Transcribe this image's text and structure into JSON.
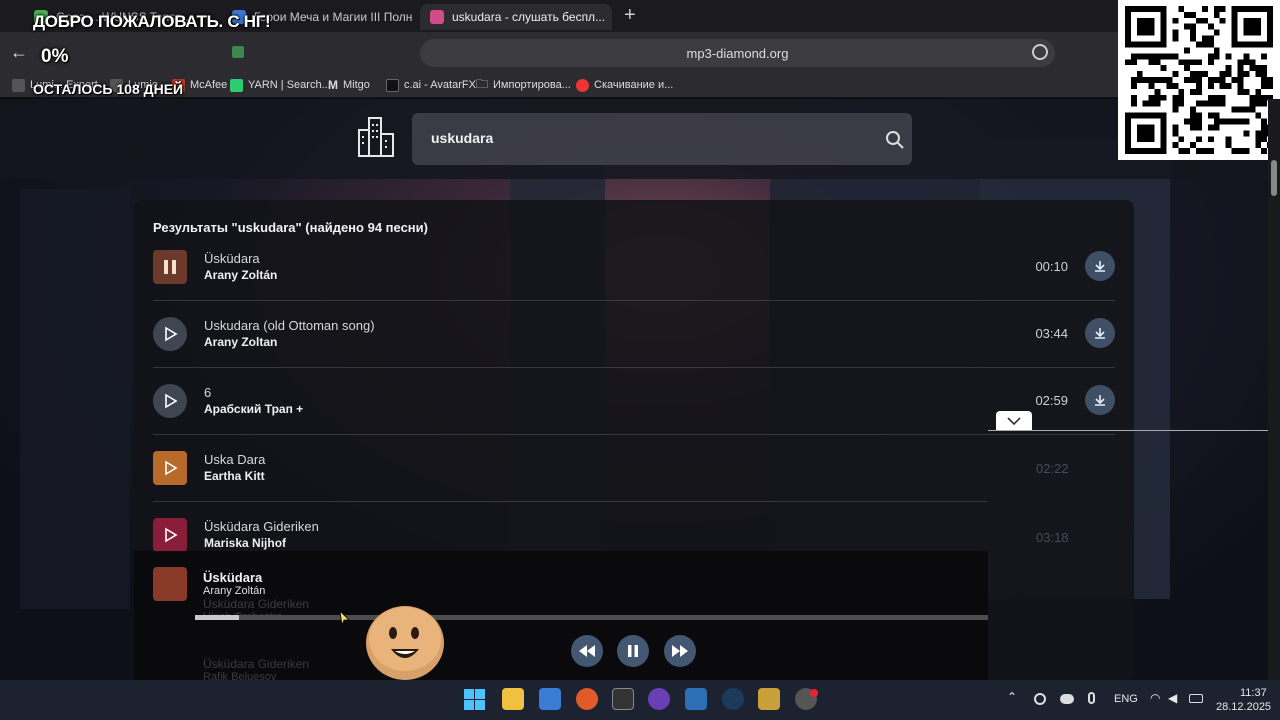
{
  "browser": {
    "tabs": [
      {
        "label": "Goga ... WUNSS Tensa..."
      },
      {
        "label": "Герои Меча и Магии III Полное с..."
      },
      {
        "label": "uskudara - слушать беспл..."
      }
    ],
    "new_tab_label": "+",
    "url": "mp3-diamond.org",
    "bookmarks": [
      {
        "label": "Lumi... Expert"
      },
      {
        "label": "Lumio..."
      },
      {
        "label": "McAfee"
      },
      {
        "label": "YARN | Search..."
      },
      {
        "label": "Mitgo"
      },
      {
        "label": "c.ai - AvatarFX"
      },
      {
        "label": "Импортирова..."
      },
      {
        "label": "Скачивание и..."
      }
    ]
  },
  "overlay": {
    "welcome": "ДОБРО ПОЖАЛОВАТЬ. С НГ!",
    "percent": "0%",
    "days_left": "ОСТАЛОСЬ 108 ДНЕЙ"
  },
  "search": {
    "query": "uskudara"
  },
  "results": {
    "heading": "Результаты \"uskudara\" (найдено 94 песни)",
    "items": [
      {
        "title": "Üsküdara",
        "artist": "Arany Zoltán",
        "duration": "00:10",
        "state": "playing"
      },
      {
        "title": "Uskudara (old Ottoman song)",
        "artist": "Arany Zoltan",
        "duration": "03:44",
        "state": "play"
      },
      {
        "title": "6",
        "artist": "Арабский Трап +",
        "duration": "02:59",
        "state": "play"
      },
      {
        "title": "Uska Dara",
        "artist": "Eartha Kitt",
        "duration": "02:22",
        "state": "play"
      },
      {
        "title": "Üsküdara Gideriken",
        "artist": "Mariska Nijhof",
        "duration": "03:18",
        "state": "play"
      },
      {
        "title": "Üsküdara Gideriken",
        "artist": "Ulrich Orchestra",
        "duration": "",
        "state": "play"
      },
      {
        "title": "Üsküdara Gideriken",
        "artist": "Rafik Beluesov",
        "duration": "",
        "state": "play"
      }
    ]
  },
  "player": {
    "title": "Üsküdara",
    "artist": "Arany Zoltán",
    "progress": 0.055
  },
  "taskbar": {
    "lang": "ENG",
    "time": "11:37",
    "date": "28.12.2025"
  },
  "colors": {
    "accent": "#435672",
    "download_btn": "#3f4f66"
  }
}
